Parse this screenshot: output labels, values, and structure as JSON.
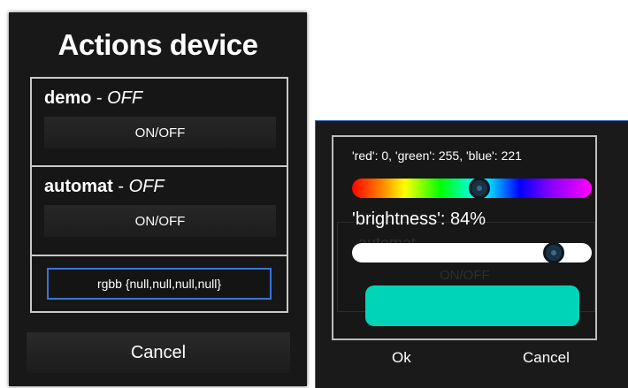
{
  "actions_dialog": {
    "title": "Actions device",
    "devices": [
      {
        "name": "demo",
        "separator": " - ",
        "state": "OFF",
        "button_label": "ON/OFF"
      },
      {
        "name": "automat",
        "separator": " - ",
        "state": "OFF",
        "button_label": "ON/OFF"
      }
    ],
    "rgbb_button_label": "rgbb {null,null,null,null}",
    "cancel_label": "Cancel"
  },
  "color_dialog": {
    "rgb_readout": "'red': 0, 'green': 255, 'blue': 221",
    "hue_fraction": 0.53,
    "brightness_label": "'brightness': 84%",
    "brightness_fraction": 0.84,
    "preview_color": "#00d4b8",
    "ok_label": "Ok",
    "cancel_label": "Cancel"
  }
}
